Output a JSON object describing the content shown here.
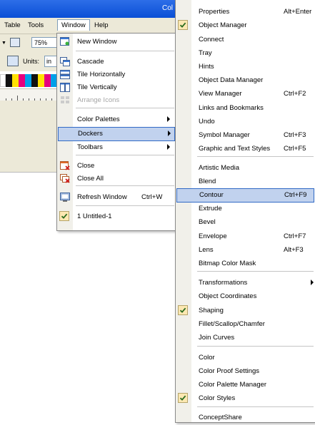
{
  "app": {
    "title_fragment": "Col",
    "menubar": [
      "Table",
      "Tools",
      "Window",
      "Help"
    ],
    "zoom": "75%",
    "units_label": "Units:",
    "units_value": "in"
  },
  "colors": {
    "title_blue": "#0a4fd6",
    "menu_highlight": "#c1d2ee",
    "highlight_border": "#316ac5",
    "gutter": "#f1f0ea",
    "check_bg": "#fce8b2"
  },
  "window_menu": {
    "items": [
      {
        "label": "New Window",
        "icon": "new-window-icon"
      },
      {
        "label": "Cascade",
        "icon": "cascade-icon"
      },
      {
        "label": "Tile Horizontally",
        "icon": "tile-horizontal-icon"
      },
      {
        "label": "Tile Vertically",
        "icon": "tile-vertical-icon"
      },
      {
        "label": "Arrange Icons",
        "icon": "arrange-icons-icon",
        "disabled": true
      },
      {
        "label": "Color Palettes",
        "submenu": true
      },
      {
        "label": "Dockers",
        "submenu": true,
        "highlighted": true
      },
      {
        "label": "Toolbars",
        "submenu": true
      },
      {
        "label": "Close",
        "icon": "close-doc-icon"
      },
      {
        "label": "Close All",
        "icon": "close-all-icon"
      },
      {
        "label": "Refresh Window",
        "shortcut": "Ctrl+W",
        "icon": "refresh-window-icon"
      },
      {
        "label": "1 Untitled-1",
        "checked": true
      }
    ]
  },
  "dockers_menu": {
    "items": [
      {
        "label": "Properties",
        "shortcut": "Alt+Enter"
      },
      {
        "label": "Object Manager",
        "checked": true
      },
      {
        "label": "Connect"
      },
      {
        "label": "Tray"
      },
      {
        "label": "Hints"
      },
      {
        "label": "Object Data Manager"
      },
      {
        "label": "View Manager",
        "shortcut": "Ctrl+F2"
      },
      {
        "label": "Links and Bookmarks"
      },
      {
        "label": "Undo"
      },
      {
        "label": "Symbol Manager",
        "shortcut": "Ctrl+F3"
      },
      {
        "label": "Graphic and Text Styles",
        "shortcut": "Ctrl+F5"
      },
      {
        "label": "Artistic Media"
      },
      {
        "label": "Blend"
      },
      {
        "label": "Contour",
        "shortcut": "Ctrl+F9",
        "highlighted": true
      },
      {
        "label": "Extrude"
      },
      {
        "label": "Bevel"
      },
      {
        "label": "Envelope",
        "shortcut": "Ctrl+F7"
      },
      {
        "label": "Lens",
        "shortcut": "Alt+F3"
      },
      {
        "label": "Bitmap Color Mask"
      },
      {
        "label": "Transformations",
        "submenu": true
      },
      {
        "label": "Object Coordinates"
      },
      {
        "label": "Shaping",
        "checked": true
      },
      {
        "label": "Fillet/Scallop/Chamfer"
      },
      {
        "label": "Join Curves"
      },
      {
        "label": "Color"
      },
      {
        "label": "Color Proof Settings"
      },
      {
        "label": "Color Palette Manager"
      },
      {
        "label": "Color Styles",
        "checked": true
      },
      {
        "label": "ConceptShare"
      }
    ]
  }
}
